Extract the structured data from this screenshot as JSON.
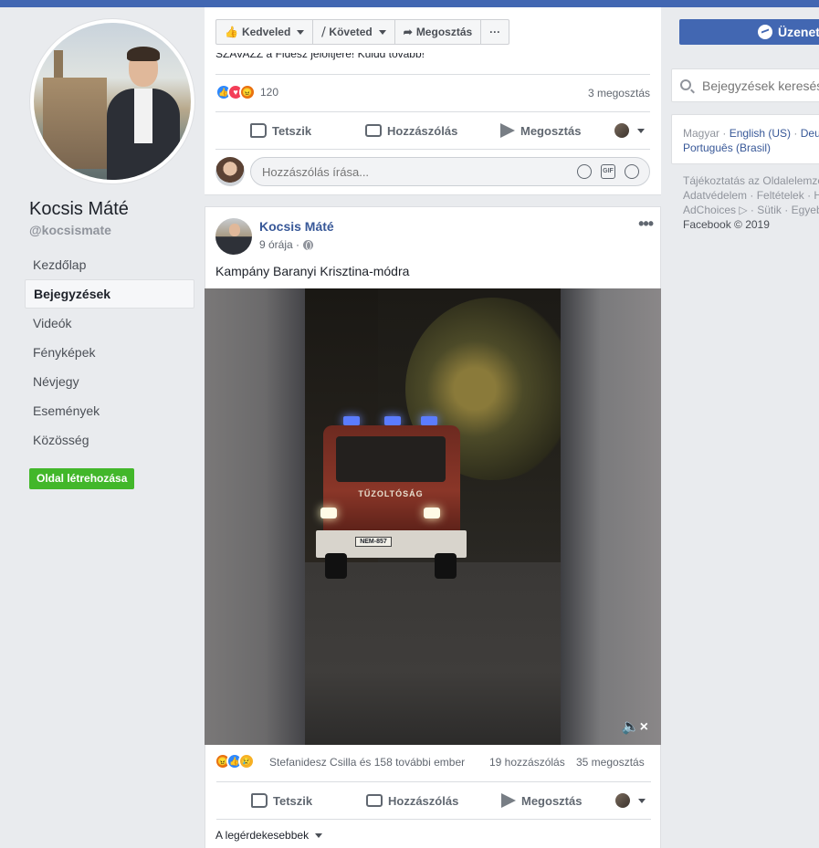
{
  "profile": {
    "name": "Kocsis Máté",
    "handle": "@kocsismate"
  },
  "left_nav": {
    "items": [
      {
        "label": "Kezdőlap"
      },
      {
        "label": "Bejegyzések",
        "active": true
      },
      {
        "label": "Videók"
      },
      {
        "label": "Fényképek"
      },
      {
        "label": "Névjegy"
      },
      {
        "label": "Események"
      },
      {
        "label": "Közösség"
      }
    ],
    "create_page": "Oldal létrehozása"
  },
  "page_actions": {
    "like": "Kedveled",
    "follow": "Követed",
    "share": "Megosztás",
    "more": "···",
    "message": "Üzenet"
  },
  "prev_post": {
    "cut_text": "SZAVAZZ a Fidesz jelöltjére! Küldd tovább!",
    "reaction_count": "120",
    "shares": "3 megosztás",
    "actions": {
      "like": "Tetszik",
      "comment": "Hozzászólás",
      "share": "Megosztás"
    },
    "comment_placeholder": "Hozzászólás írása...",
    "gif_label": "GIF"
  },
  "post": {
    "author": "Kocsis Máté",
    "time": "9 órája ·",
    "more": "•••",
    "text": "Kampány Baranyi Krisztina-módra",
    "video": {
      "truck_label": "TŰZOLTÓSÁG",
      "plate": "NEM-857",
      "mute_icon": "🔈×"
    },
    "reactions_by": "Stefanidesz Csilla és 158 további ember",
    "comments": "19 hozzászólás",
    "shares": "35 megosztás",
    "actions": {
      "like": "Tetszik",
      "comment": "Hozzászólás",
      "share": "Megosztás"
    },
    "sort": "A legérdekesebbek"
  },
  "sidebar": {
    "search_placeholder": "Bejegyzések keresése",
    "languages": {
      "current": "Magyar ·",
      "links": [
        "English (US)",
        "Deutsch",
        "Português (Brasil)"
      ]
    },
    "footer": {
      "line1": "Tájékoztatás az Oldalelemzésekről",
      "line2": "Adatvédelem · Feltételek · Hirdetések",
      "line3": "AdChoices ▷ · Sütik · Egyebek",
      "copyright": "Facebook © 2019"
    }
  },
  "colors": {
    "brand": "#4267b2",
    "link": "#385898",
    "create_green": "#42b72a",
    "background": "#e9ebee"
  }
}
